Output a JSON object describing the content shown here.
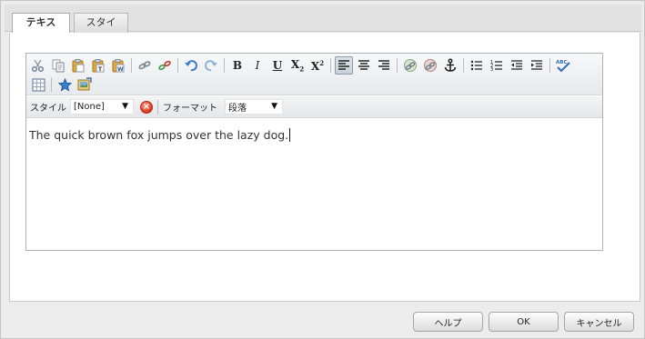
{
  "tabs": [
    {
      "label": "テキスト",
      "active": true
    },
    {
      "label": "スタイル",
      "active": false
    }
  ],
  "toolbar": {
    "row1": [
      "cut-icon",
      "copy-icon",
      "paste-icon",
      "paste-text-icon",
      "paste-word-icon",
      "link-icon",
      "unlink-icon",
      "undo-icon",
      "redo-icon",
      "bold-icon",
      "italic-icon",
      "underline-icon",
      "subscript-icon",
      "superscript-icon",
      "align-left-icon",
      "align-center-icon",
      "align-right-icon",
      "internal-link-icon",
      "external-link-icon",
      "anchor-icon",
      "bullet-list-icon",
      "numbered-list-icon",
      "outdent-icon",
      "indent-icon",
      "spellcheck-icon"
    ],
    "row2": [
      "table-icon",
      "special-char-icon",
      "image-icon"
    ],
    "active": "align-left-icon"
  },
  "stylebar": {
    "style_label": "スタイル",
    "style_value": "[None]",
    "format_label": "フォーマット",
    "format_value": "段落"
  },
  "editor": {
    "text": "The quick brown fox jumps over the lazy dog."
  },
  "footer": {
    "help_label": "ヘルプ",
    "ok_label": "OK",
    "cancel_label": "キャンセル"
  },
  "colors": {
    "accent_blue": "#2f6db5",
    "clear_red": "#d9361e",
    "panel_bg": "#ececec"
  }
}
